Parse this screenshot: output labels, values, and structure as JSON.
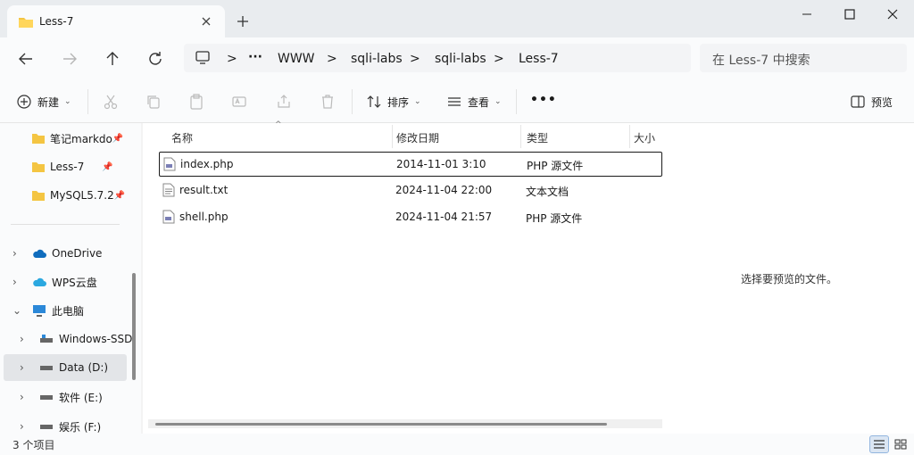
{
  "window": {
    "tab_title": "Less-7",
    "colors": {
      "folder": "#f4c542",
      "accent": "#0067c0",
      "selection": "#e3e5e8"
    }
  },
  "nav": {
    "breadcrumb": [
      "WWW",
      "sqli-labs",
      "sqli-labs",
      "Less-7"
    ],
    "more": "···",
    "search_placeholder": "在 Less-7 中搜索"
  },
  "toolbar": {
    "new_label": "新建",
    "sort_label": "排序",
    "view_label": "查看",
    "more": "•••",
    "preview_label": "预览"
  },
  "sidebar": {
    "quick": [
      {
        "label": "笔记markdo",
        "icon": "folder-icon",
        "pinned": true
      },
      {
        "label": "Less-7",
        "icon": "folder-icon",
        "pinned": true
      },
      {
        "label": "MySQL5.7.2",
        "icon": "folder-icon",
        "pinned": true
      }
    ],
    "tree": [
      {
        "label": "OneDrive",
        "icon": "cloud-icon",
        "expander": ">"
      },
      {
        "label": "WPS云盘",
        "icon": "cloud-icon",
        "expander": ">"
      },
      {
        "label": "此电脑",
        "icon": "monitor-icon",
        "expander": "v"
      },
      {
        "label": "Windows-SSD",
        "icon": "drive-icon",
        "expander": ">"
      },
      {
        "label": "Data (D:)",
        "icon": "drive-icon",
        "expander": ">"
      },
      {
        "label": "软件 (E:)",
        "icon": "drive-icon",
        "expander": ">"
      },
      {
        "label": "娱乐 (F:)",
        "icon": "drive-icon",
        "expander": ">"
      }
    ]
  },
  "columns": {
    "name": "名称",
    "date": "修改日期",
    "type": "类型",
    "size": "大小"
  },
  "files": [
    {
      "name": "index.php",
      "date": "2014-11-01 3:10",
      "type": "PHP 源文件",
      "icon": "php-file-icon"
    },
    {
      "name": "result.txt",
      "date": "2024-11-04 22:00",
      "type": "文本文档",
      "icon": "text-file-icon"
    },
    {
      "name": "shell.php",
      "date": "2024-11-04 21:57",
      "type": "PHP 源文件",
      "icon": "php-file-icon"
    }
  ],
  "preview": {
    "message": "选择要预览的文件。"
  },
  "status": {
    "item_count": "3 个项目"
  }
}
